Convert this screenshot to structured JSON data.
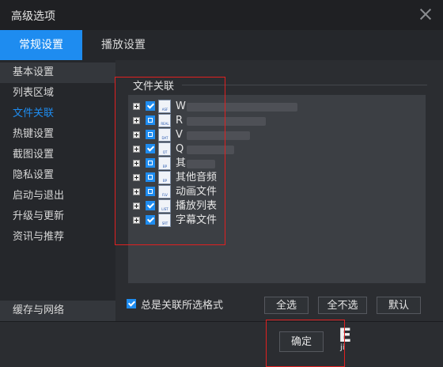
{
  "window": {
    "title": "高级选项"
  },
  "tabs": [
    {
      "label": "常规设置",
      "active": true
    },
    {
      "label": "播放设置",
      "active": false
    }
  ],
  "sidebar": {
    "items": [
      {
        "label": "基本设置"
      },
      {
        "label": "列表区域"
      },
      {
        "label": "文件关联"
      },
      {
        "label": "热键设置"
      },
      {
        "label": "截图设置"
      },
      {
        "label": "隐私设置"
      },
      {
        "label": "启动与退出"
      },
      {
        "label": "升级与更新"
      },
      {
        "label": "资讯与推荐"
      }
    ],
    "bottom_item": "缓存与网络",
    "active_index": 2
  },
  "file_assoc": {
    "group_label": "文件关联",
    "tree": [
      {
        "name": "W",
        "icon_text": "ASF",
        "checked": true
      },
      {
        "name": "R",
        "icon_text": "REAL",
        "checked": false
      },
      {
        "name": "V",
        "icon_text": "DAT",
        "checked": false
      },
      {
        "name": "Q",
        "icon_text": "QT",
        "checked": true
      },
      {
        "name": "其",
        "icon_text": "BP",
        "checked": false
      },
      {
        "name": "其他音频",
        "icon_text": "BP",
        "checked": false
      },
      {
        "name": "动画文件",
        "icon_text": "FLV",
        "checked": false
      },
      {
        "name": "播放列表",
        "icon_text": "LIST",
        "checked": true
      },
      {
        "name": "字幕文件",
        "icon_text": "SRT",
        "checked": true
      }
    ],
    "always_assoc_label": "总是关联所选格式",
    "always_assoc_checked": true,
    "buttons": {
      "select_all": "全选",
      "select_none": "全不选",
      "default": "默认"
    }
  },
  "footer": {
    "ok_label": "确定"
  },
  "watermark": {
    "big": "E",
    "small": "ji"
  },
  "colors": {
    "accent": "#1e8cf0",
    "highlight": "#e02020"
  }
}
